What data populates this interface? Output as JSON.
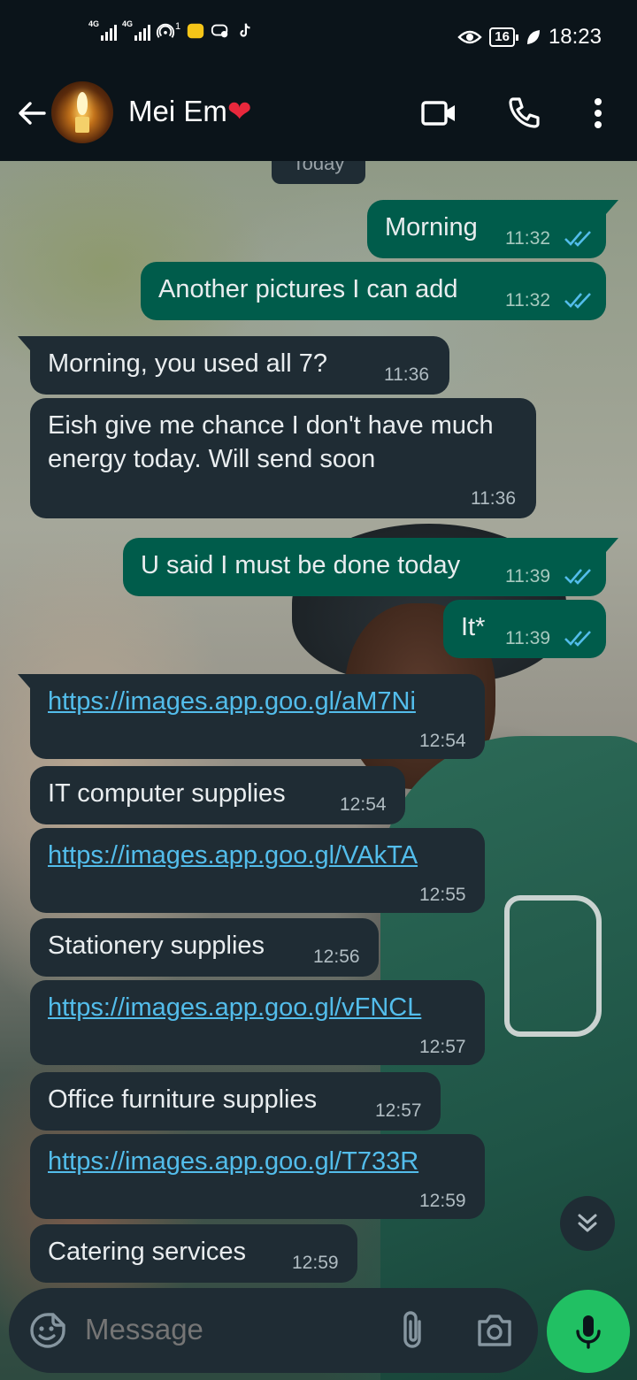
{
  "status_bar": {
    "sim1": "4G",
    "sim2": "4G",
    "hotspot_badge": "1",
    "battery": "16",
    "time": "18:23"
  },
  "header": {
    "contact_name": "Mei Em",
    "heart": "❤"
  },
  "chat": {
    "date_chip": "Today",
    "messages": [
      {
        "dir": "out",
        "text": "Morning",
        "time": "11:32"
      },
      {
        "dir": "out",
        "text": "Another pictures I can add",
        "time": "11:32"
      },
      {
        "dir": "in",
        "text": "Morning,  you used all 7?",
        "time": "11:36"
      },
      {
        "dir": "in",
        "text": "Eish give me chance I don't have much energy today. Will send soon",
        "time": "11:36"
      },
      {
        "dir": "out",
        "text": "U said I must be done today",
        "time": "11:39"
      },
      {
        "dir": "out",
        "text": "It*",
        "time": "11:39"
      },
      {
        "dir": "in",
        "text": "https://images.app.goo.gl/aM7Ni",
        "time": "12:54",
        "link": true
      },
      {
        "dir": "in",
        "text": "IT computer supplies",
        "time": "12:54"
      },
      {
        "dir": "in",
        "text": "https://images.app.goo.gl/VAkTA",
        "time": "12:55",
        "link": true
      },
      {
        "dir": "in",
        "text": "Stationery supplies",
        "time": "12:56"
      },
      {
        "dir": "in",
        "text": "https://images.app.goo.gl/vFNCL",
        "time": "12:57",
        "link": true
      },
      {
        "dir": "in",
        "text": "Office furniture supplies",
        "time": "12:57"
      },
      {
        "dir": "in",
        "text": "https://images.app.goo.gl/T733R",
        "time": "12:59",
        "link": true
      },
      {
        "dir": "in",
        "text": "Catering services",
        "time": "12:59"
      }
    ]
  },
  "composer": {
    "placeholder": "Message"
  },
  "colors": {
    "incoming_bubble": "#1f2c34",
    "outgoing_bubble": "#005c4b",
    "link": "#53bdeb",
    "read_ticks": "#53bdeb",
    "mic_button": "#21c063"
  },
  "icons": [
    "back-arrow-icon",
    "video-call-icon",
    "phone-icon",
    "more-options-icon",
    "sticker-icon",
    "attach-icon",
    "camera-icon",
    "mic-icon",
    "chevron-double-down-icon"
  ]
}
